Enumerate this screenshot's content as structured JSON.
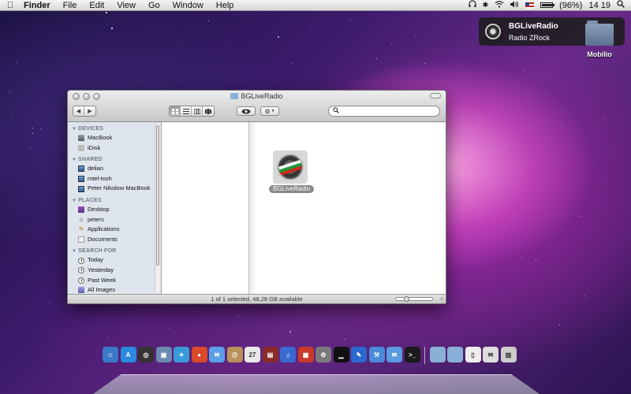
{
  "menubar": {
    "apple_icon": "apple-icon",
    "app_name": "Finder",
    "menus": [
      "File",
      "Edit",
      "View",
      "Go",
      "Window",
      "Help"
    ],
    "battery_text": "(96%)",
    "battery_level": 0.96,
    "clock": "14 19",
    "status_icons": [
      "headphones-icon",
      "bluetooth-icon",
      "wifi-icon",
      "volume-icon",
      "flag-icon",
      "battery-icon",
      "spotlight-icon"
    ]
  },
  "notification": {
    "title": "BGLiveRadio",
    "message": "Radio ZRock"
  },
  "desktop": {
    "folder_label": "Mobilio"
  },
  "finder": {
    "title": "BGLiveRadio",
    "nav_back": "◀",
    "nav_forward": "▶",
    "view_modes": [
      "icon",
      "list",
      "column",
      "coverflow"
    ],
    "active_view": "icon",
    "search_placeholder": "",
    "sidebar": {
      "sections": [
        {
          "heading": "DEVICES",
          "items": [
            {
              "label": "MacBook",
              "icon": "macbook"
            },
            {
              "label": "iDisk",
              "icon": "idisk"
            }
          ]
        },
        {
          "heading": "SHARED",
          "items": [
            {
              "label": "delian",
              "icon": "host"
            },
            {
              "label": "mtel-tosh",
              "icon": "host"
            },
            {
              "label": "Peter Nikolow MacBook",
              "icon": "host"
            }
          ]
        },
        {
          "heading": "PLACES",
          "items": [
            {
              "label": "Desktop",
              "icon": "desktop"
            },
            {
              "label": "peters",
              "icon": "home"
            },
            {
              "label": "Applications",
              "icon": "applications"
            },
            {
              "label": "Documents",
              "icon": "documents"
            }
          ]
        },
        {
          "heading": "SEARCH FOR",
          "items": [
            {
              "label": "Today",
              "icon": "clock"
            },
            {
              "label": "Yesterday",
              "icon": "clock"
            },
            {
              "label": "Past Week",
              "icon": "clock"
            },
            {
              "label": "All Images",
              "icon": "images"
            }
          ]
        }
      ]
    },
    "files": [
      {
        "name": "BGLiveRadio",
        "selected": true
      }
    ],
    "status_text": "1 of 1 selected, 48,28 GB available",
    "icon_size_slider": 0.25
  },
  "dock": {
    "apps": [
      {
        "name": "Finder",
        "icon": "finder-icon",
        "color": "#3a78c8",
        "glyph": "☺"
      },
      {
        "name": "App Store",
        "icon": "appstore-icon",
        "color": "#2a8ae0",
        "glyph": "A"
      },
      {
        "name": "Dashboard",
        "icon": "dashboard-icon",
        "color": "#333333",
        "glyph": "◎"
      },
      {
        "name": "Preview",
        "icon": "preview-icon",
        "color": "#6a8ab0",
        "glyph": "▣"
      },
      {
        "name": "Safari",
        "icon": "safari-icon",
        "color": "#3a9ad8",
        "glyph": "✦"
      },
      {
        "name": "Chrome",
        "icon": "chrome-icon",
        "color": "#d84a2a",
        "glyph": "●"
      },
      {
        "name": "iChat",
        "icon": "ichat-icon",
        "color": "#5aa0e8",
        "glyph": "✉"
      },
      {
        "name": "Address Book",
        "icon": "addressbook-icon",
        "color": "#b8925a",
        "glyph": "@"
      },
      {
        "name": "iCal",
        "icon": "ical-icon",
        "color": "#e8e8e8",
        "glyph": "27"
      },
      {
        "name": "Photo Booth",
        "icon": "photobooth-icon",
        "color": "#8a2a2a",
        "glyph": "▤"
      },
      {
        "name": "iTunes",
        "icon": "itunes-icon",
        "color": "#3a6ad0",
        "glyph": "♫"
      },
      {
        "name": "Photos",
        "icon": "photos-icon",
        "color": "#c83a2a",
        "glyph": "▦"
      },
      {
        "name": "System Preferences",
        "icon": "preferences-icon",
        "color": "#7a7a7a",
        "glyph": "⚙"
      },
      {
        "name": "Activity Monitor",
        "icon": "activity-icon",
        "color": "#111111",
        "glyph": "▁"
      },
      {
        "name": "Xcode",
        "icon": "xcode-icon",
        "color": "#2a6ad0",
        "glyph": "✎"
      },
      {
        "name": "Utilities",
        "icon": "utilities-icon",
        "color": "#4a8ad8",
        "glyph": "⚒"
      },
      {
        "name": "Dictionary",
        "icon": "dictionary-icon",
        "color": "#5a9ae0",
        "glyph": "✉"
      },
      {
        "name": "Terminal",
        "icon": "terminal-icon",
        "color": "#1a1a1a",
        "glyph": ">_"
      }
    ],
    "stacks": [
      {
        "name": "Applications",
        "icon": "folder-icon",
        "color": "#8ab0d8",
        "glyph": ""
      },
      {
        "name": "Documents",
        "icon": "folder-icon",
        "color": "#8ab0d8",
        "glyph": ""
      },
      {
        "name": "Downloads",
        "icon": "document-icon",
        "color": "#eeeeee",
        "glyph": "▯"
      },
      {
        "name": "Mail",
        "icon": "mail-icon",
        "color": "#dddddd",
        "glyph": "✉"
      },
      {
        "name": "Trash",
        "icon": "trash-icon",
        "color": "#cccccc",
        "glyph": "▥"
      }
    ]
  }
}
